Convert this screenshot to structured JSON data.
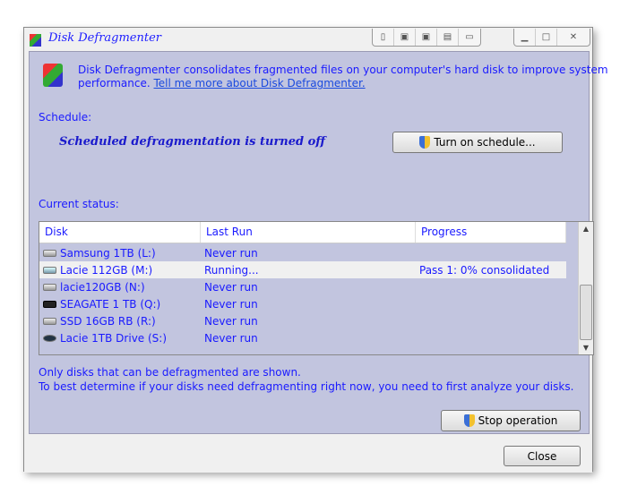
{
  "window": {
    "title": "Disk Defragmenter"
  },
  "intro": {
    "text": "Disk Defragmenter consolidates fragmented files on your computer's hard disk to improve system",
    "text2": "performance.",
    "link": "Tell me more about Disk Defragmenter."
  },
  "schedule": {
    "label": "Schedule:",
    "status": "Scheduled defragmentation is turned off",
    "button": "Turn on schedule..."
  },
  "current": {
    "label": "Current status:"
  },
  "table": {
    "columns": [
      "Disk",
      "Last Run",
      "Progress"
    ],
    "rows": [
      {
        "disk": "Samsung 1TB (L:)",
        "last_run": "Never run",
        "progress": "",
        "icon": "hard-drive-icon"
      },
      {
        "disk": "Lacie 112GB (M:)",
        "last_run": "Running...",
        "progress": "Pass 1: 0% consolidated",
        "icon": "hard-drive-icon"
      },
      {
        "disk": "lacie120GB (N:)",
        "last_run": "Never run",
        "progress": "",
        "icon": "hard-drive-icon"
      },
      {
        "disk": "SEAGATE 1 TB (Q:)",
        "last_run": "Never run",
        "progress": "",
        "icon": "external-drive-icon"
      },
      {
        "disk": "SSD 16GB RB (R:)",
        "last_run": "Never run",
        "progress": "",
        "icon": "hard-drive-icon"
      },
      {
        "disk": "Lacie 1TB Drive (S:)",
        "last_run": "Never run",
        "progress": "",
        "icon": "lacie-drive-icon"
      }
    ]
  },
  "notes": [
    "Only disks that can be defragmented are shown.",
    "To best determine if your disks need defragmenting right now, you need to first analyze your disks."
  ],
  "buttons": {
    "stop": "Stop operation",
    "close": "Close"
  }
}
